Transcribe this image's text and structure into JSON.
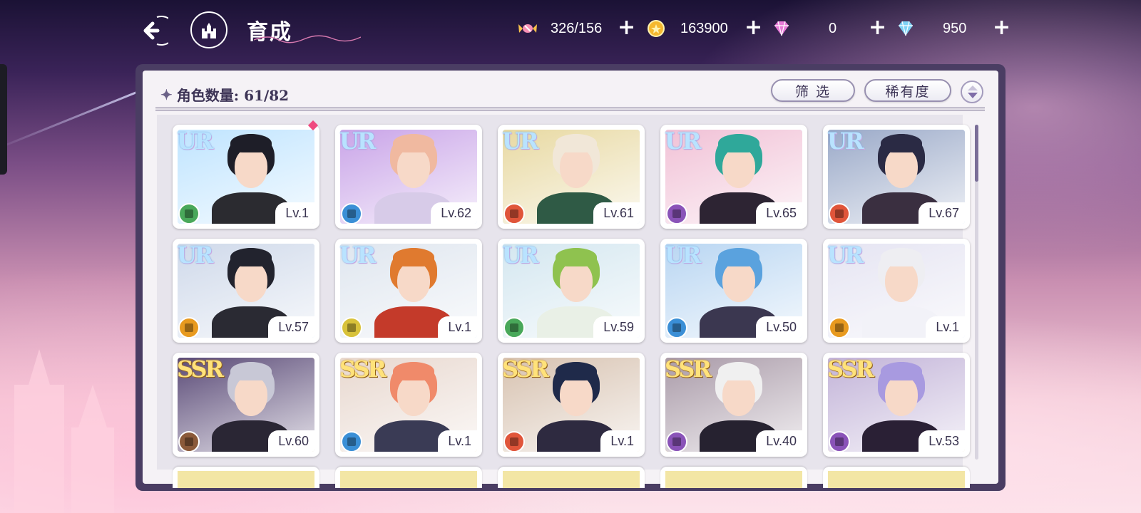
{
  "header": {
    "title": "育成",
    "resources": [
      {
        "icon": "candy-icon",
        "value": "326/156"
      },
      {
        "icon": "gold-coin-icon",
        "value": "163900"
      },
      {
        "icon": "pink-diamond-icon",
        "value": "0"
      },
      {
        "icon": "blue-diamond-icon",
        "value": "950"
      }
    ],
    "plus": "+"
  },
  "panel": {
    "count_label": "角色数量: 61/82",
    "filter_label": "筛 选",
    "rarity_label": "稀有度"
  },
  "colors": {
    "attr_green": "#49a85a",
    "attr_blue": "#3b8fd6",
    "attr_red": "#e0553a",
    "attr_purple": "#8a53b8",
    "attr_yellow": "#d8c23a",
    "attr_orange": "#e89a1f",
    "attr_brown": "#8b5a3a"
  },
  "cards": [
    {
      "rarity": "UR",
      "level": "Lv.1",
      "attr": "green",
      "new": true
    },
    {
      "rarity": "UR",
      "level": "Lv.62",
      "attr": "blue"
    },
    {
      "rarity": "UR",
      "level": "Lv.61",
      "attr": "red"
    },
    {
      "rarity": "UR",
      "level": "Lv.65",
      "attr": "purple"
    },
    {
      "rarity": "UR",
      "level": "Lv.67",
      "attr": "red"
    },
    {
      "rarity": "UR",
      "level": "Lv.57",
      "attr": "orange"
    },
    {
      "rarity": "UR",
      "level": "Lv.1",
      "attr": "yellow"
    },
    {
      "rarity": "UR",
      "level": "Lv.59",
      "attr": "green"
    },
    {
      "rarity": "UR",
      "level": "Lv.50",
      "attr": "blue"
    },
    {
      "rarity": "UR",
      "level": "Lv.1",
      "attr": "orange"
    },
    {
      "rarity": "SSR",
      "level": "Lv.60",
      "attr": "brown"
    },
    {
      "rarity": "SSR",
      "level": "Lv.1",
      "attr": "blue"
    },
    {
      "rarity": "SSR",
      "level": "Lv.1",
      "attr": "red"
    },
    {
      "rarity": "SSR",
      "level": "Lv.40",
      "attr": "purple"
    },
    {
      "rarity": "SSR",
      "level": "Lv.53",
      "attr": "purple"
    }
  ]
}
